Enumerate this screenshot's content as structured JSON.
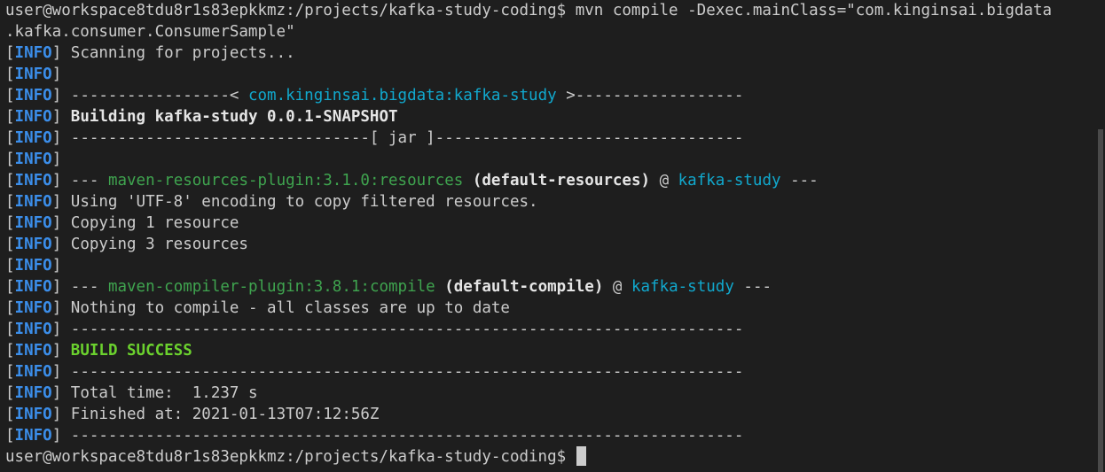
{
  "prompt": {
    "text": "user@workspace8tdu8r1s83epkkmz:/projects/kafka-study-coding$"
  },
  "command": {
    "line1": " mvn compile -Dexec.mainClass=\"com.kinginsai.bigdata",
    "line2": ".kafka.consumer.ConsumerSample\""
  },
  "info": {
    "open": "[",
    "kw": "INFO",
    "close": "]"
  },
  "log": {
    "scanning": " Scanning for projects...",
    "sep1_left": " -----------------< ",
    "artifact": "com.kinginsai.bigdata:kafka-study",
    "sep1_right": " >------------------",
    "building": " Building kafka-study 0.0.1-SNAPSHOT",
    "jar_line": " --------------------------------[ jar ]---------------------------------",
    "dashes_open": " --- ",
    "resources_plugin": "maven-resources-plugin:3.1.0:resources",
    "default_resources": " (default-resources)",
    "at": " @ ",
    "project": "kafka-study",
    "dashes_close": " ---",
    "using_utf8": " Using 'UTF-8' encoding to copy filtered resources.",
    "copying1": " Copying 1 resource",
    "copying3": " Copying 3 resources",
    "compiler_plugin": "maven-compiler-plugin:3.8.1:compile",
    "default_compile": " (default-compile)",
    "nothing": " Nothing to compile - all classes are up to date",
    "long_sep": " ------------------------------------------------------------------------",
    "build_success": "BUILD SUCCESS",
    "total_time": " Total time:  1.237 s",
    "finished_at": " Finished at: 2021-01-13T07:12:56Z"
  },
  "colors": {
    "background": "#1e1e1e",
    "text": "#cccccc",
    "info_keyword": "#3b8eea",
    "plugin": "#3fa44f",
    "artifact": "#11a8cd",
    "success": "#6bd12e"
  }
}
